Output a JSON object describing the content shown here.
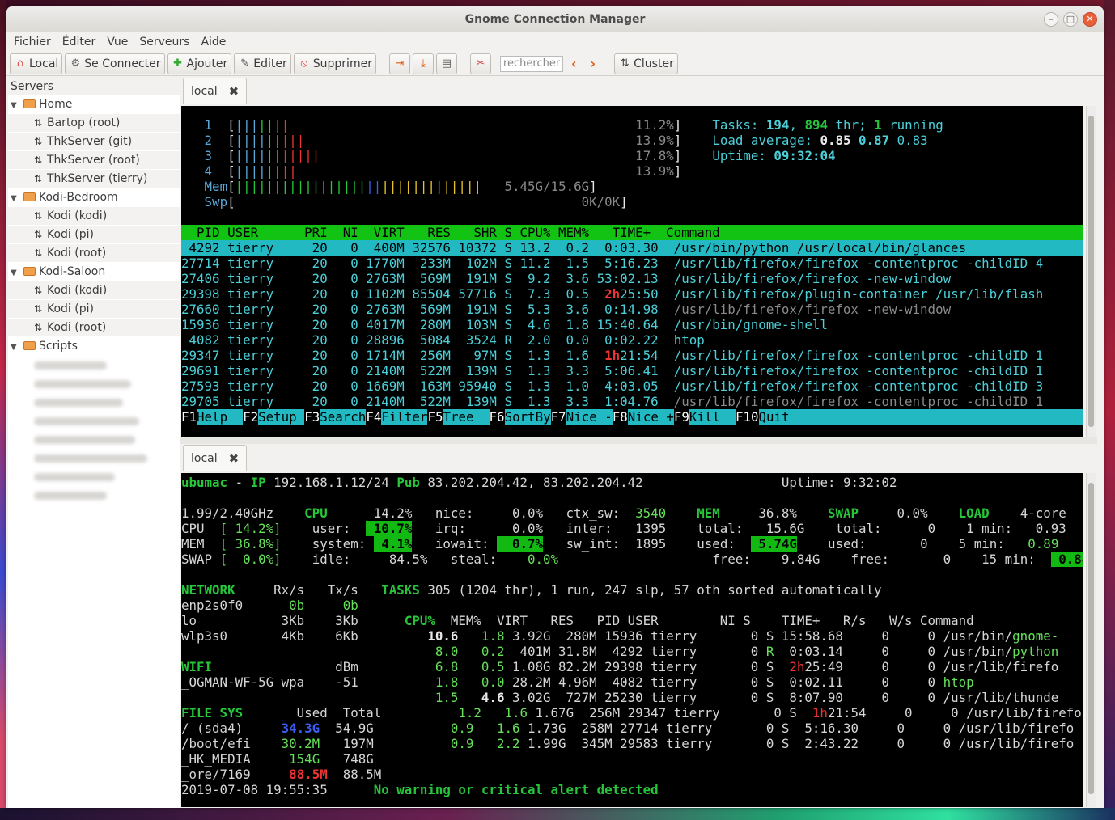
{
  "window": {
    "title": "Gnome Connection Manager"
  },
  "menu": [
    "Fichier",
    "Éditer",
    "Vue",
    "Serveurs",
    "Aide"
  ],
  "toolbar": {
    "local": "Local",
    "connect": "Se Connecter",
    "add": "Ajouter",
    "edit": "Editer",
    "delete": "Supprimer",
    "search_placeholder": "rechercher",
    "cluster": "Cluster"
  },
  "sidebar": {
    "header": "Servers",
    "groups": [
      {
        "name": "Home",
        "hosts": [
          "Bartop (root)",
          "ThkServer (git)",
          "ThkServer (root)",
          "ThkServer (tierry)"
        ]
      },
      {
        "name": "Kodi-Bedroom",
        "hosts": [
          "Kodi (kodi)",
          "Kodi (pi)",
          "Kodi (root)"
        ]
      },
      {
        "name": "Kodi-Saloon",
        "hosts": [
          "Kodi (kodi)",
          "Kodi (pi)",
          "Kodi (root)"
        ]
      },
      {
        "name": "Scripts",
        "hosts": []
      }
    ]
  },
  "tab_top": {
    "label": "local"
  },
  "tab_bottom": {
    "label": "local"
  },
  "htop": {
    "cpus": [
      {
        "n": "1",
        "pct": "11.2%"
      },
      {
        "n": "2",
        "pct": "13.9%"
      },
      {
        "n": "3",
        "pct": "17.8%"
      },
      {
        "n": "4",
        "pct": "13.9%"
      }
    ],
    "mem": "5.45G/15.6G",
    "swp": "0K/0K",
    "tasks": "194",
    "thr": "894",
    "running": "1",
    "load": [
      "0.85",
      "0.87",
      "0.83"
    ],
    "uptime": "09:32:04",
    "header": "  PID USER      PRI  NI  VIRT   RES   SHR S CPU% MEM%   TIME+  Command",
    "rows": [
      [
        "4292",
        "tierry",
        "20",
        "0",
        "400M",
        "32576",
        "10372",
        "S",
        "13.2",
        "0.2",
        "0:03.30",
        "/usr/bin/python /usr/local/bin/glances"
      ],
      [
        "27714",
        "tierry",
        "20",
        "0",
        "1770M",
        "233M",
        "102M",
        "S",
        "11.2",
        "1.5",
        "5:16.23",
        "/usr/lib/firefox/firefox -contentproc -childID 4"
      ],
      [
        "27406",
        "tierry",
        "20",
        "0",
        "2763M",
        "569M",
        "191M",
        "S",
        "9.2",
        "3.6",
        "53:02.13",
        "/usr/lib/firefox/firefox -new-window"
      ],
      [
        "29398",
        "tierry",
        "20",
        "0",
        "1102M",
        "85504",
        "57716",
        "S",
        "7.3",
        "0.5",
        "2h25:50",
        "/usr/lib/firefox/plugin-container /usr/lib/flash"
      ],
      [
        "27660",
        "tierry",
        "20",
        "0",
        "2763M",
        "569M",
        "191M",
        "S",
        "5.3",
        "3.6",
        "0:14.98",
        "/usr/lib/firefox/firefox -new-window"
      ],
      [
        "15936",
        "tierry",
        "20",
        "0",
        "4017M",
        "280M",
        "103M",
        "S",
        "4.6",
        "1.8",
        "15:40.64",
        "/usr/bin/gnome-shell"
      ],
      [
        "4082",
        "tierry",
        "20",
        "0",
        "28896",
        "5084",
        "3524",
        "R",
        "2.0",
        "0.0",
        "0:02.22",
        "htop"
      ],
      [
        "29347",
        "tierry",
        "20",
        "0",
        "1714M",
        "256M",
        "97M",
        "S",
        "1.3",
        "1.6",
        "1h21:54",
        "/usr/lib/firefox/firefox -contentproc -childID 1"
      ],
      [
        "29691",
        "tierry",
        "20",
        "0",
        "2140M",
        "522M",
        "139M",
        "S",
        "1.3",
        "3.3",
        "5:06.41",
        "/usr/lib/firefox/firefox -contentproc -childID 1"
      ],
      [
        "27593",
        "tierry",
        "20",
        "0",
        "1669M",
        "163M",
        "95940",
        "S",
        "1.3",
        "1.0",
        "4:03.05",
        "/usr/lib/firefox/firefox -contentproc -childID 3"
      ],
      [
        "29705",
        "tierry",
        "20",
        "0",
        "2140M",
        "522M",
        "139M",
        "S",
        "1.3",
        "3.3",
        "1:04.76",
        "/usr/lib/firefox/firefox -contentproc -childID 1"
      ]
    ],
    "fkeys": [
      [
        "F1",
        "Help  "
      ],
      [
        "F2",
        "Setup "
      ],
      [
        "F3",
        "Search"
      ],
      [
        "F4",
        "Filter"
      ],
      [
        "F5",
        "Tree  "
      ],
      [
        "F6",
        "SortBy"
      ],
      [
        "F7",
        "Nice -"
      ],
      [
        "F8",
        "Nice +"
      ],
      [
        "F9",
        "Kill  "
      ],
      [
        "F10",
        "Quit"
      ]
    ]
  },
  "glances": {
    "host": "ubumac",
    "ip": "192.168.1.12/24",
    "pub": "83.202.204.42, 83.202.204.42",
    "uptime": "Uptime: 9:32:02",
    "freq": "1.99/2.40GHz",
    "alert": "No warning or critical alert detected",
    "datetime": "2019-07-08 19:55:35"
  }
}
